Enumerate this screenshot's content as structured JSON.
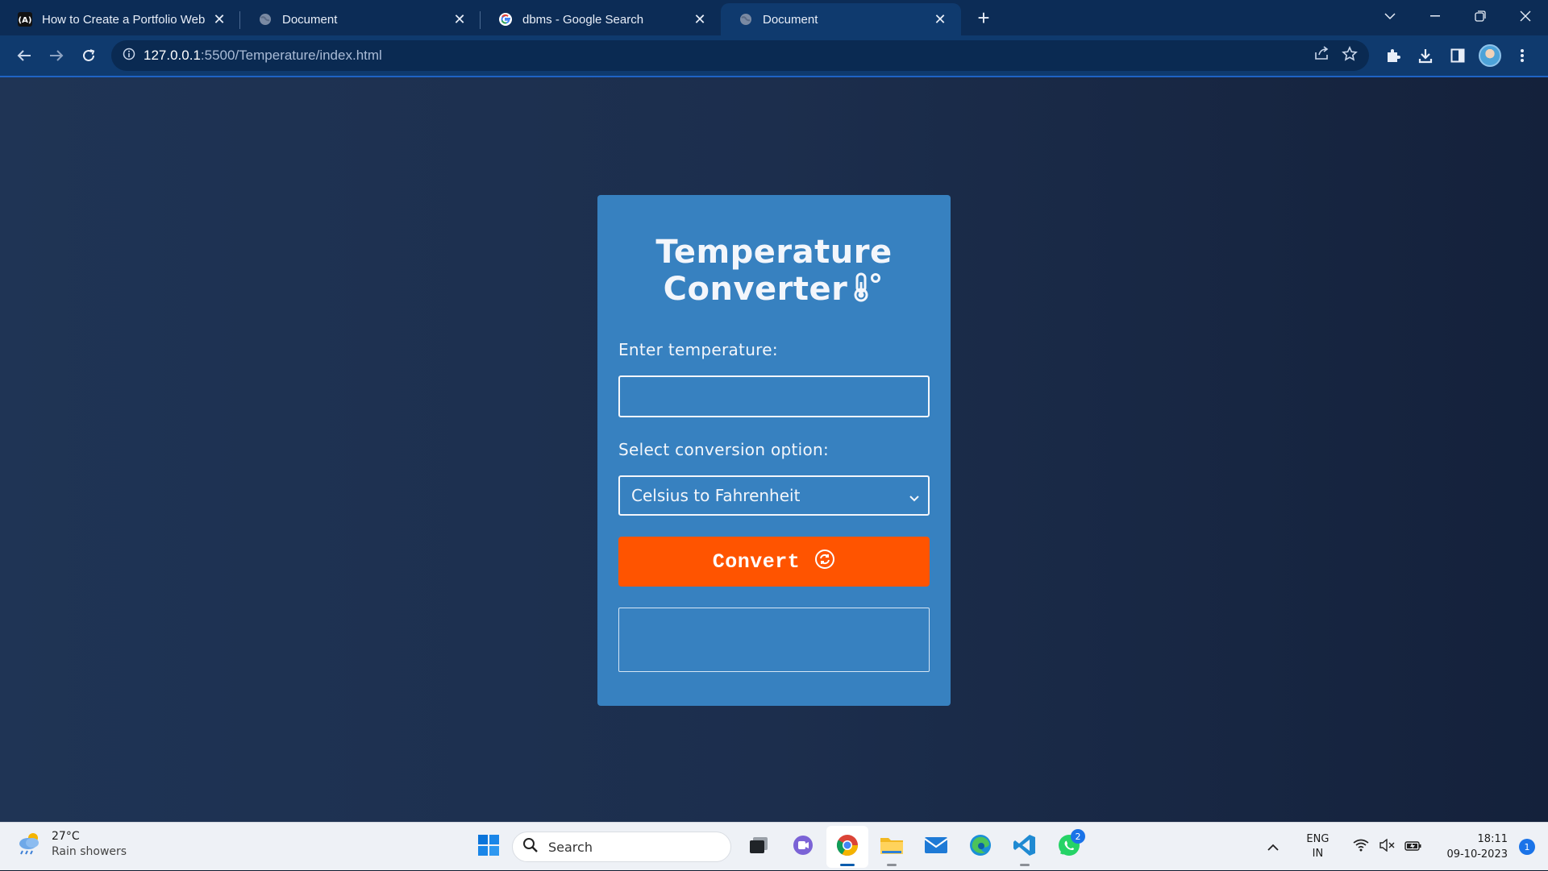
{
  "browser": {
    "tabs": [
      {
        "title": "How to Create a Portfolio Websi",
        "favicon": "a-logo-icon",
        "active": false
      },
      {
        "title": "Document",
        "favicon": "globe-icon",
        "active": false
      },
      {
        "title": "dbms - Google Search",
        "favicon": "google-icon",
        "active": false
      },
      {
        "title": "Document",
        "favicon": "globe-icon",
        "active": true
      }
    ],
    "url_host": "127.0.0.1",
    "url_path": ":5500/Temperature/index.html"
  },
  "page": {
    "title_line1": "Temperature",
    "title_line2": "Converter",
    "enter_label": "Enter temperature:",
    "temperature_value": "",
    "select_label": "Select conversion option:",
    "selected_option": "Celsius to Fahrenheit",
    "convert_label": "Convert",
    "result_text": "",
    "colors": {
      "card": "#3781c0",
      "button": "#ff5400",
      "background": "#1c2e4d"
    }
  },
  "taskbar": {
    "weather_temp": "27°C",
    "weather_condition": "Rain showers",
    "search_placeholder": "Search",
    "whatsapp_badge": "2",
    "lang_line1": "ENG",
    "lang_line2": "IN",
    "time": "18:11",
    "date": "09-10-2023",
    "notification_count": "1"
  }
}
